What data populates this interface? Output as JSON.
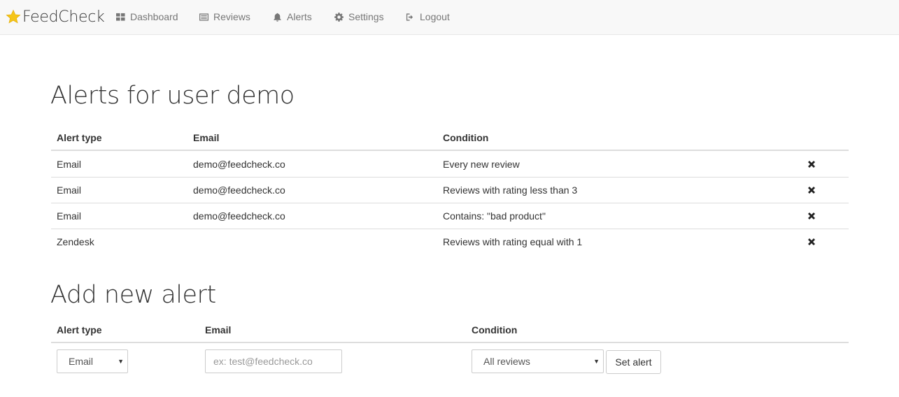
{
  "navbar": {
    "brand": "FeedCheck",
    "items": [
      {
        "label": "Dashboard",
        "icon": "dashboard-icon"
      },
      {
        "label": "Reviews",
        "icon": "list-icon"
      },
      {
        "label": "Alerts",
        "icon": "bell-icon"
      },
      {
        "label": "Settings",
        "icon": "gear-icon"
      },
      {
        "label": "Logout",
        "icon": "logout-icon"
      }
    ]
  },
  "alerts": {
    "title": "Alerts for user demo",
    "columns": [
      "Alert type",
      "Email",
      "Condition"
    ],
    "rows": [
      {
        "type": "Email",
        "email": "demo@feedcheck.co",
        "condition": "Every new review"
      },
      {
        "type": "Email",
        "email": "demo@feedcheck.co",
        "condition": "Reviews with rating less than 3"
      },
      {
        "type": "Email",
        "email": "demo@feedcheck.co",
        "condition": "Contains: \"bad product\""
      },
      {
        "type": "Zendesk",
        "email": "",
        "condition": "Reviews with rating equal with 1"
      }
    ]
  },
  "add_alert": {
    "title": "Add new alert",
    "columns": [
      "Alert type",
      "Email",
      "Condition"
    ],
    "type_value": "Email",
    "email_placeholder": "ex: test@feedcheck.co",
    "condition_value": "All reviews",
    "submit_label": "Set alert"
  },
  "colors": {
    "navbar_bg": "#f8f8f8",
    "nav_text": "#777777",
    "star": "#f5c518"
  }
}
